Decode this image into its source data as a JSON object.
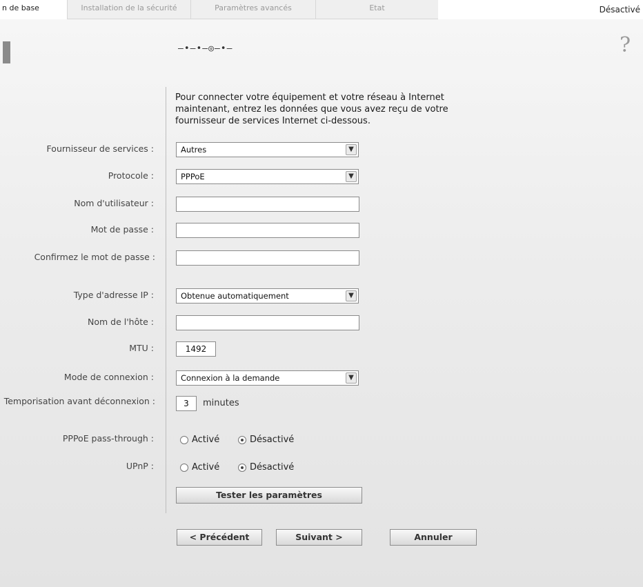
{
  "tabs": [
    {
      "label": "n de base",
      "active": true
    },
    {
      "label": "Installation de la sécurité",
      "active": false
    },
    {
      "label": "Paramètres avancés",
      "active": false
    },
    {
      "label": "Etat",
      "active": false
    }
  ],
  "status_top": "Désactivé",
  "progress_indicator": "–•—•—◎—•–",
  "help_label": "?",
  "intro": "Pour connecter votre équipement et votre réseau à Internet maintenant, entrez les données que vous avez reçu de votre fournisseur de services Internet ci-dessous.",
  "form": {
    "provider": {
      "label": "Fournisseur de services :",
      "value": "Autres"
    },
    "protocol": {
      "label": "Protocole :",
      "value": "PPPoE"
    },
    "username": {
      "label": "Nom d'utilisateur :",
      "value": ""
    },
    "password": {
      "label": "Mot de passe :",
      "value": ""
    },
    "confirm_password": {
      "label": "Confirmez le mot de passe :",
      "value": ""
    },
    "ip_type": {
      "label": "Type d'adresse IP :",
      "value": "Obtenue automatiquement"
    },
    "hostname": {
      "label": "Nom de l'hôte :",
      "value": ""
    },
    "mtu": {
      "label": "MTU :",
      "value": "1492"
    },
    "connection_mode": {
      "label": "Mode de connexion :",
      "value": "Connexion à la demande"
    },
    "timeout": {
      "label": "Temporisation avant déconnexion :",
      "value": "3",
      "unit": "minutes"
    },
    "pppoe_passthrough": {
      "label": "PPPoE pass-through :",
      "option_on": "Activé",
      "option_off": "Désactivé",
      "selected": "Désactivé"
    },
    "upnp": {
      "label": "UPnP :",
      "option_on": "Activé",
      "option_off": "Désactivé",
      "selected": "Désactivé"
    }
  },
  "buttons": {
    "test": "Tester les paramètres",
    "previous": "< Précédent",
    "next": "Suivant >",
    "cancel": "Annuler"
  },
  "icons": {
    "dropdown": "chevron-down-icon",
    "help": "help-icon"
  }
}
